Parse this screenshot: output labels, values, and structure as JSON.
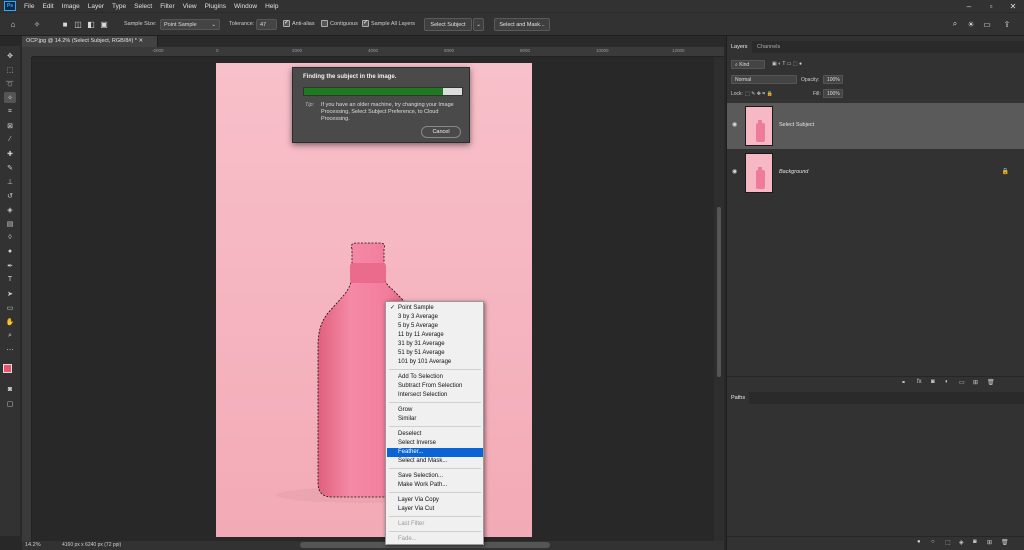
{
  "menubar": {
    "logo": "Ps",
    "items": [
      "File",
      "Edit",
      "Image",
      "Layer",
      "Type",
      "Select",
      "Filter",
      "View",
      "Plugins",
      "Window",
      "Help"
    ]
  },
  "options": {
    "sample_size_label": "Sample Size:",
    "sample_size_value": "Point Sample",
    "tolerance_label": "Tolerance:",
    "tolerance_value": "47",
    "anti_alias": "Anti-alias",
    "contiguous": "Contiguous",
    "sample_all_layers": "Sample All Layers",
    "select_subject": "Select Subject",
    "select_and_mask": "Select and Mask..."
  },
  "document": {
    "tab_title": "OCP.jpg @ 14.2% (Select Subject, RGB/8#) *",
    "zoom": "14.2%",
    "dimensions": "4160 px x 6240 px (72 ppi)",
    "ruler_ticks": [
      "-2000",
      "0",
      "2000",
      "4000",
      "6000",
      "8000",
      "10000",
      "12000"
    ]
  },
  "dialog": {
    "title": "Finding the subject in the image.",
    "progress": 0.88,
    "tip_label": "Tip:",
    "tip_text": "If you have an older machine, try changing your Image Processing, Select Subject Preference, to Cloud Processing.",
    "cancel": "Cancel"
  },
  "context_menu": {
    "groups": [
      [
        {
          "label": "Point Sample",
          "checked": true
        },
        {
          "label": "3 by 3 Average"
        },
        {
          "label": "5 by 5 Average"
        },
        {
          "label": "11 by 11 Average"
        },
        {
          "label": "31 by 31 Average"
        },
        {
          "label": "51 by 51 Average"
        },
        {
          "label": "101 by 101 Average"
        }
      ],
      [
        {
          "label": "Add To Selection"
        },
        {
          "label": "Subtract From Selection"
        },
        {
          "label": "Intersect Selection"
        }
      ],
      [
        {
          "label": "Grow"
        },
        {
          "label": "Similar"
        }
      ],
      [
        {
          "label": "Deselect"
        },
        {
          "label": "Select Inverse"
        },
        {
          "label": "Feather...",
          "selected": true
        },
        {
          "label": "Select and Mask..."
        }
      ],
      [
        {
          "label": "Save Selection..."
        },
        {
          "label": "Make Work Path..."
        }
      ],
      [
        {
          "label": "Layer Via Copy"
        },
        {
          "label": "Layer Via Cut"
        }
      ],
      [
        {
          "label": "Last Filter",
          "disabled": true
        }
      ],
      [
        {
          "label": "Fade...",
          "disabled": true
        }
      ]
    ]
  },
  "layers_panel": {
    "tabs": [
      "Layers",
      "Channels"
    ],
    "filter_kind": "Kind",
    "blend_mode": "Normal",
    "opacity_label": "Opacity:",
    "opacity_value": "100%",
    "lock_label": "Lock:",
    "fill_label": "Fill:",
    "fill_value": "100%",
    "layers": [
      {
        "name": "Select Subject",
        "selected": true,
        "locked": false
      },
      {
        "name": "Background",
        "selected": false,
        "locked": true
      }
    ]
  },
  "paths_panel": {
    "tab": "Paths"
  },
  "colors": {
    "photo_bg": "#f6b9c3",
    "bottle": "#f07c9c",
    "progress_fill": "#1e7a1e",
    "menu_highlight": "#0a64d6",
    "foreground_swatch": "#e8546c"
  }
}
